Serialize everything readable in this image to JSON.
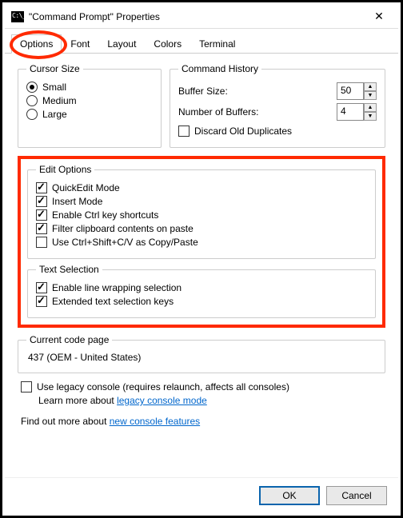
{
  "window": {
    "title": "\"Command Prompt\" Properties",
    "close_glyph": "✕"
  },
  "tabs": {
    "options": "Options",
    "font": "Font",
    "layout": "Layout",
    "colors": "Colors",
    "terminal": "Terminal"
  },
  "cursor_size": {
    "legend": "Cursor Size",
    "small": "Small",
    "medium": "Medium",
    "large": "Large"
  },
  "command_history": {
    "legend": "Command History",
    "buffer_label": "Buffer Size:",
    "buffer_value": "50",
    "numbuf_label": "Number of Buffers:",
    "numbuf_value": "4",
    "discard_label": "Discard Old Duplicates"
  },
  "edit_options": {
    "legend": "Edit Options",
    "quickedit": "QuickEdit Mode",
    "insert": "Insert Mode",
    "ctrl_shortcuts": "Enable Ctrl key shortcuts",
    "filter_clipboard": "Filter clipboard contents on paste",
    "ctrl_shift_cv": "Use Ctrl+Shift+C/V as Copy/Paste"
  },
  "text_selection": {
    "legend": "Text Selection",
    "line_wrap": "Enable line wrapping selection",
    "extended_keys": "Extended text selection keys"
  },
  "codepage": {
    "legend": "Current code page",
    "value": "437   (OEM - United States)"
  },
  "legacy": {
    "checkbox_label": "Use legacy console (requires relaunch, affects all consoles)",
    "learn_prefix": "Learn more about ",
    "learn_link": "legacy console mode"
  },
  "findout": {
    "prefix": "Find out more about ",
    "link": "new console features"
  },
  "buttons": {
    "ok": "OK",
    "cancel": "Cancel"
  },
  "glyphs": {
    "up": "▲",
    "down": "▼"
  }
}
